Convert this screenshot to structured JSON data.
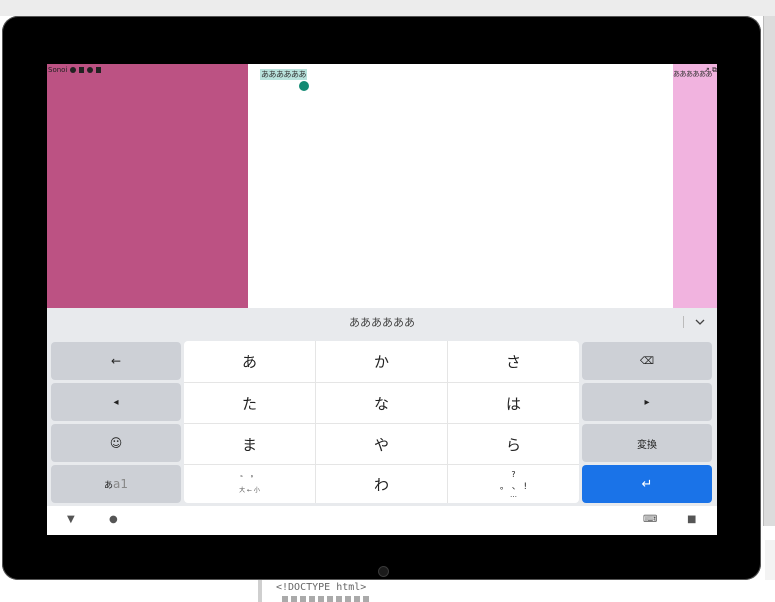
{
  "desktop": {
    "code_snippet": "<!DOCTYPE html>"
  },
  "status_left": {
    "text": "Sonoi"
  },
  "status_right": {
    "text": "↗ ⧉"
  },
  "editor": {
    "selected_text": "ああああああ",
    "right_text": "ああああああ"
  },
  "colors": {
    "left_pane": "#bc5283",
    "right_pane": "#f1b3df",
    "keyboard_bg": "#e8eaed",
    "enter_key": "#1a73e8",
    "selection": "#b8e2dc",
    "handle": "#138a73"
  },
  "keyboard": {
    "candidate": "ああああああ",
    "candidate_expand_icon": "chevron-down-icon",
    "left_keys": {
      "undo": "←",
      "cursor_left": "◂",
      "emoji": "☺",
      "mode_prefix": "あ",
      "mode_suffix": "a1"
    },
    "right_keys": {
      "backspace": "⌫",
      "cursor_right": "▸",
      "convert": "変換",
      "enter": "↵"
    },
    "kana_rows": [
      [
        "あ",
        "か",
        "さ"
      ],
      [
        "た",
        "な",
        "は"
      ],
      [
        "ま",
        "や",
        "ら"
      ]
    ],
    "bottom_row": {
      "dakuten_top": "゛ ゜",
      "dakuten_bottom": "大 ← 小",
      "wa": "わ",
      "punct_top": "?",
      "punct_mid": "。 、 !",
      "punct_bottom": "…"
    }
  },
  "navbar": {
    "back": "▼",
    "home": "●",
    "keyboard_switch": "⌨",
    "recents": "■"
  }
}
